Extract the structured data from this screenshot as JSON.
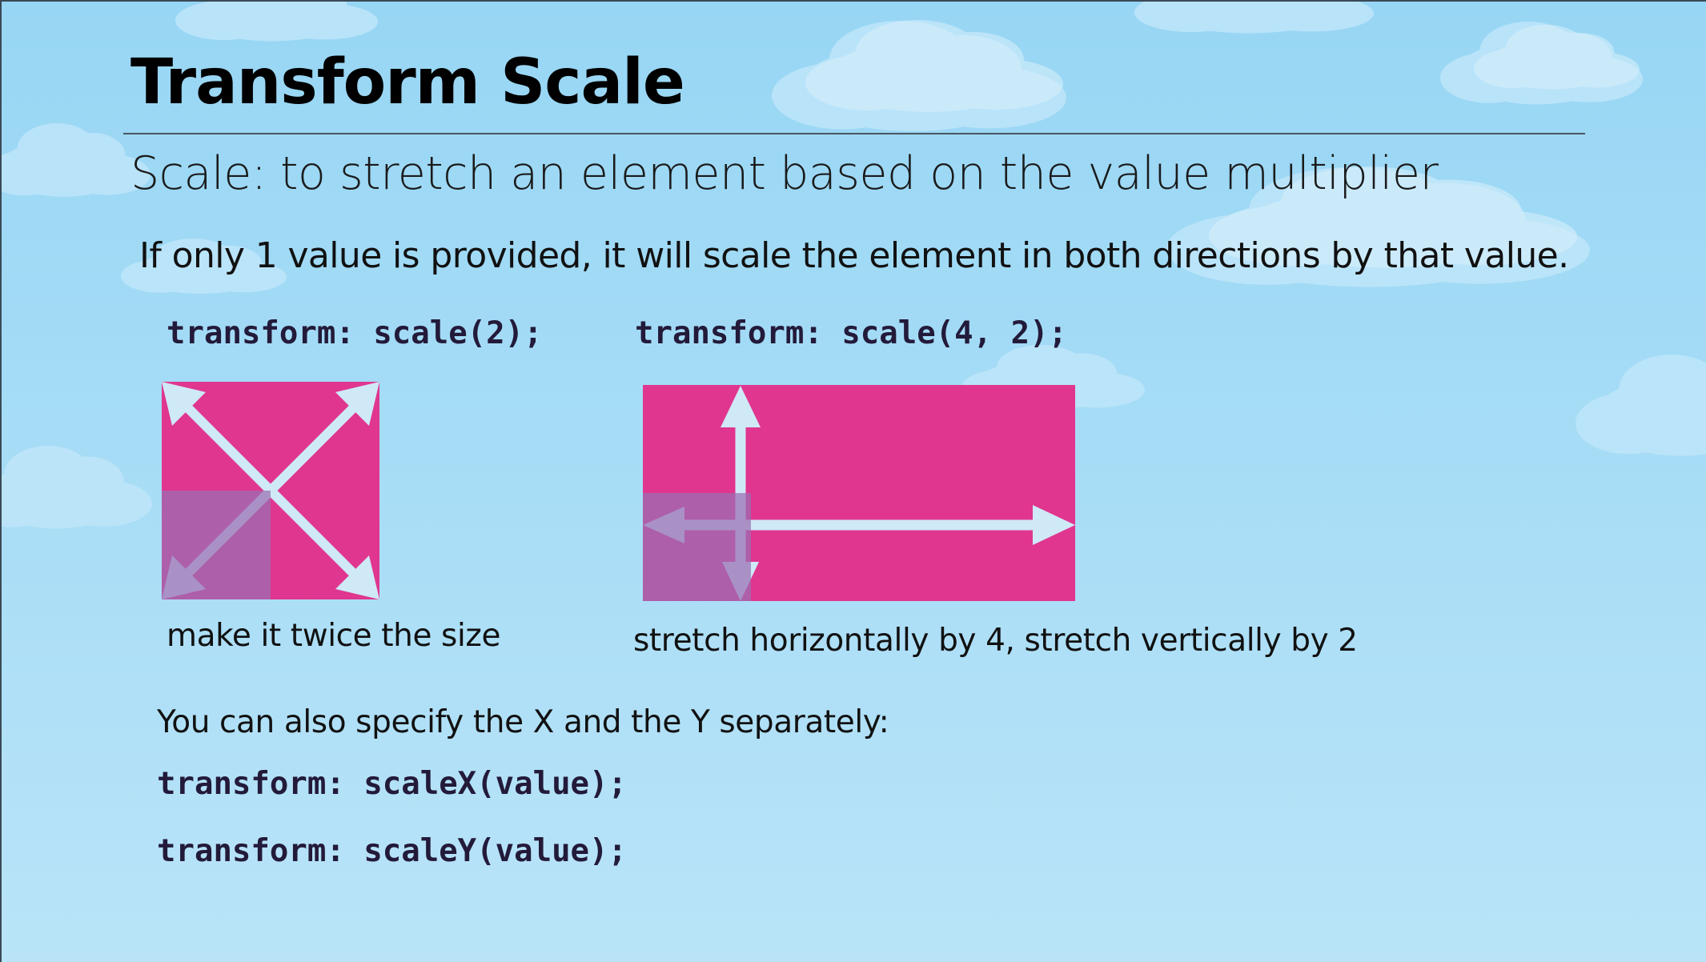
{
  "slide": {
    "title": "Transform Scale",
    "subtitle": "Scale: to stretch an element based on the value multiplier",
    "intro": "If only 1 value is provided, it will scale the element in both directions by that value."
  },
  "examples": [
    {
      "code": "transform: scale(2);",
      "caption": "make it twice the size",
      "icon": "diagonal-arrows-diagram"
    },
    {
      "code": "transform: scale(4, 2);",
      "caption": "stretch horizontally by 4, stretch vertically by 2",
      "icon": "horizontal-vertical-arrows-diagram"
    }
  ],
  "separate": {
    "text": "You can also specify the X and the Y separately:",
    "code_x": "transform: scaleX(value);",
    "code_y": "transform: scaleY(value);"
  },
  "colors": {
    "box_pink": "#e0368f",
    "original_box": "#b04fa0",
    "arrow": "#cfe9f7",
    "background_top": "#97d6f4",
    "background_bottom": "#b9e4f8"
  }
}
